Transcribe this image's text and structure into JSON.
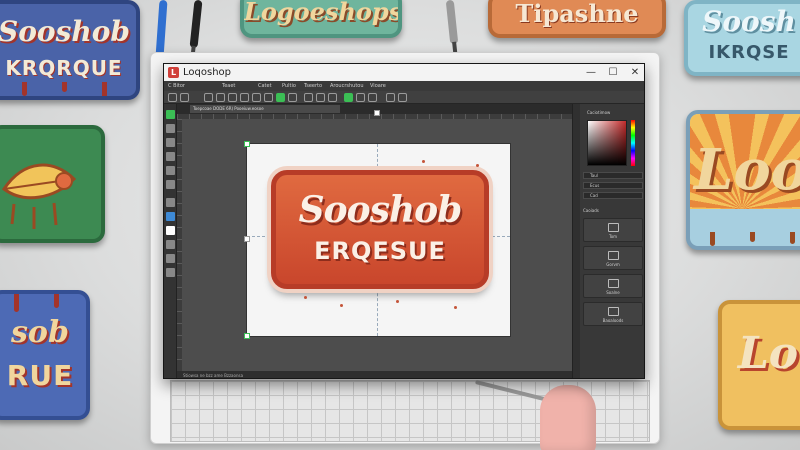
{
  "decor": {
    "sign_top_left": {
      "line1": "Sooshob",
      "line2": "KRQRQUE"
    },
    "sign_top_center": {
      "line1": "Logoeshops"
    },
    "sign_top_right": {
      "line1": "Tipashne"
    },
    "sign_far_right": {
      "line1": "Soosh",
      "line2": "IKRQSE"
    },
    "sign_right": {
      "line1": "Loo"
    },
    "sign_bottom_left": {
      "line1": "sob",
      "line2": "RUE"
    },
    "sign_bottom_right": {
      "line1": "Lo"
    }
  },
  "window": {
    "title": "Loqoshop",
    "controls": {
      "minimize": "—",
      "maximize": "☐",
      "close": "✕"
    }
  },
  "menu": [
    "C Bitor",
    "Teaet",
    "Catet",
    "Pultio",
    "Tseerto",
    "Aroucrshutou",
    "Vioare"
  ],
  "document": {
    "tab_label": "Toepcoae DODE 6R) Pooeiuw.eosoe",
    "status": "Stiowsa ne bzz ame Bzzaonsa"
  },
  "logo": {
    "line1": "Sooshob",
    "line2": "ERQESUE",
    "colors": {
      "fill": "#c9462c",
      "border": "#b73c27",
      "text": "#fbf0e6"
    }
  },
  "panels": {
    "color_title": "Caciotimow",
    "field_1": "Taul",
    "field_2": "Ecus",
    "field_3": "Cad",
    "section_label": "Caoiads",
    "button_1": "Tom",
    "button_2": "Gorvm",
    "button_3": "Soalne",
    "button_4": "Baoaloods"
  }
}
